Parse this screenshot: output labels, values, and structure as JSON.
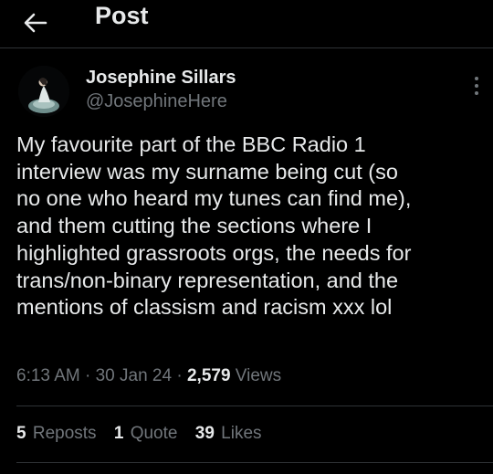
{
  "header": {
    "title": "Post"
  },
  "author": {
    "name": "Josephine Sillars",
    "handle": "@JosephineHere"
  },
  "tweet": {
    "text": "My favourite part of the BBC Radio 1\ninterview was my surname being cut (so\nno one who heard my tunes can find me),\nand them cutting the sections where I\nhighlighted grassroots orgs, the needs for\ntrans/non-binary representation, and the\nmentions of classism and racism xxx lol"
  },
  "meta": {
    "time": "6:13 AM",
    "sep1": " · ",
    "date": "30 Jan 24",
    "sep2": " · ",
    "views_count": "2,579",
    "views_label": " Views"
  },
  "stats": {
    "reposts_count": "5",
    "reposts_label": "Reposts",
    "quotes_count": "1",
    "quotes_label": "Quote",
    "likes_count": "39",
    "likes_label": "Likes"
  },
  "icons": {
    "back": "arrow-left-icon",
    "more": "more-vertical-icon"
  },
  "colors": {
    "background": "#000000",
    "text": "#e7e9ea",
    "secondary": "#71767b",
    "divider": "#2f3336"
  }
}
